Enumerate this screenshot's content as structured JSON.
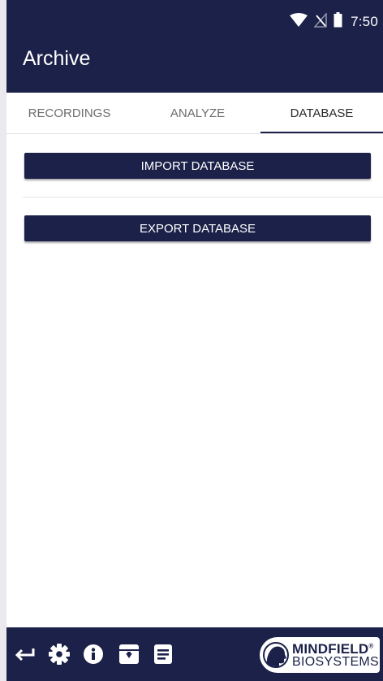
{
  "status_bar": {
    "time": "7:50",
    "icons": [
      "wifi-icon",
      "no-sim-icon",
      "battery-icon"
    ]
  },
  "app_bar": {
    "title": "Archive"
  },
  "tabs": [
    {
      "label": "RECORDINGS",
      "active": false
    },
    {
      "label": "ANALYZE",
      "active": false
    },
    {
      "label": "DATABASE",
      "active": true
    }
  ],
  "actions": {
    "import_label": "IMPORT DATABASE",
    "export_label": "EXPORT DATABASE"
  },
  "bottom_bar": {
    "icons": [
      "back-arrow-icon",
      "gear-icon",
      "info-icon",
      "archive-icon",
      "notes-icon"
    ],
    "logo": {
      "line1": "MINDFIELD",
      "registered": "®",
      "line2": "BIOSYSTEMS"
    }
  },
  "colors": {
    "brand_navy": "#1b2149",
    "background": "#ffffff",
    "tab_inactive": "#6d6d6d",
    "tab_active": "#2a2a2a"
  }
}
